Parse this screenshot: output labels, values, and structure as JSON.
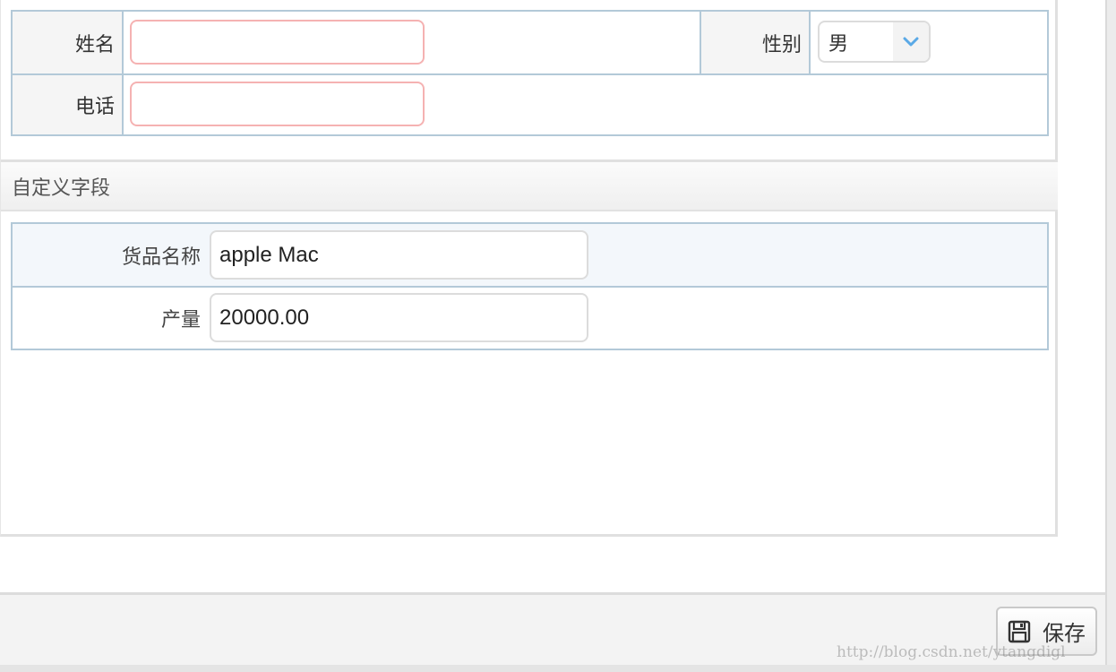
{
  "basic_form": {
    "name_label": "姓名",
    "name_value": "",
    "gender_label": "性别",
    "gender_selected": "男",
    "phone_label": "电话",
    "phone_value": ""
  },
  "custom_section": {
    "title": "自定义字段",
    "fields": [
      {
        "label": "货品名称",
        "value": "apple Mac"
      },
      {
        "label": "产量",
        "value": "20000.00"
      }
    ]
  },
  "toolbar": {
    "save_label": "保存",
    "save_icon": "floppy-disk-icon"
  },
  "watermark": "http://blog.csdn.net/ytangdigl",
  "colors": {
    "table_border": "#b3c9d8",
    "required_border": "#f5b2b2",
    "select_arrow": "#5aa9e6",
    "header_bg": "#efefef"
  }
}
